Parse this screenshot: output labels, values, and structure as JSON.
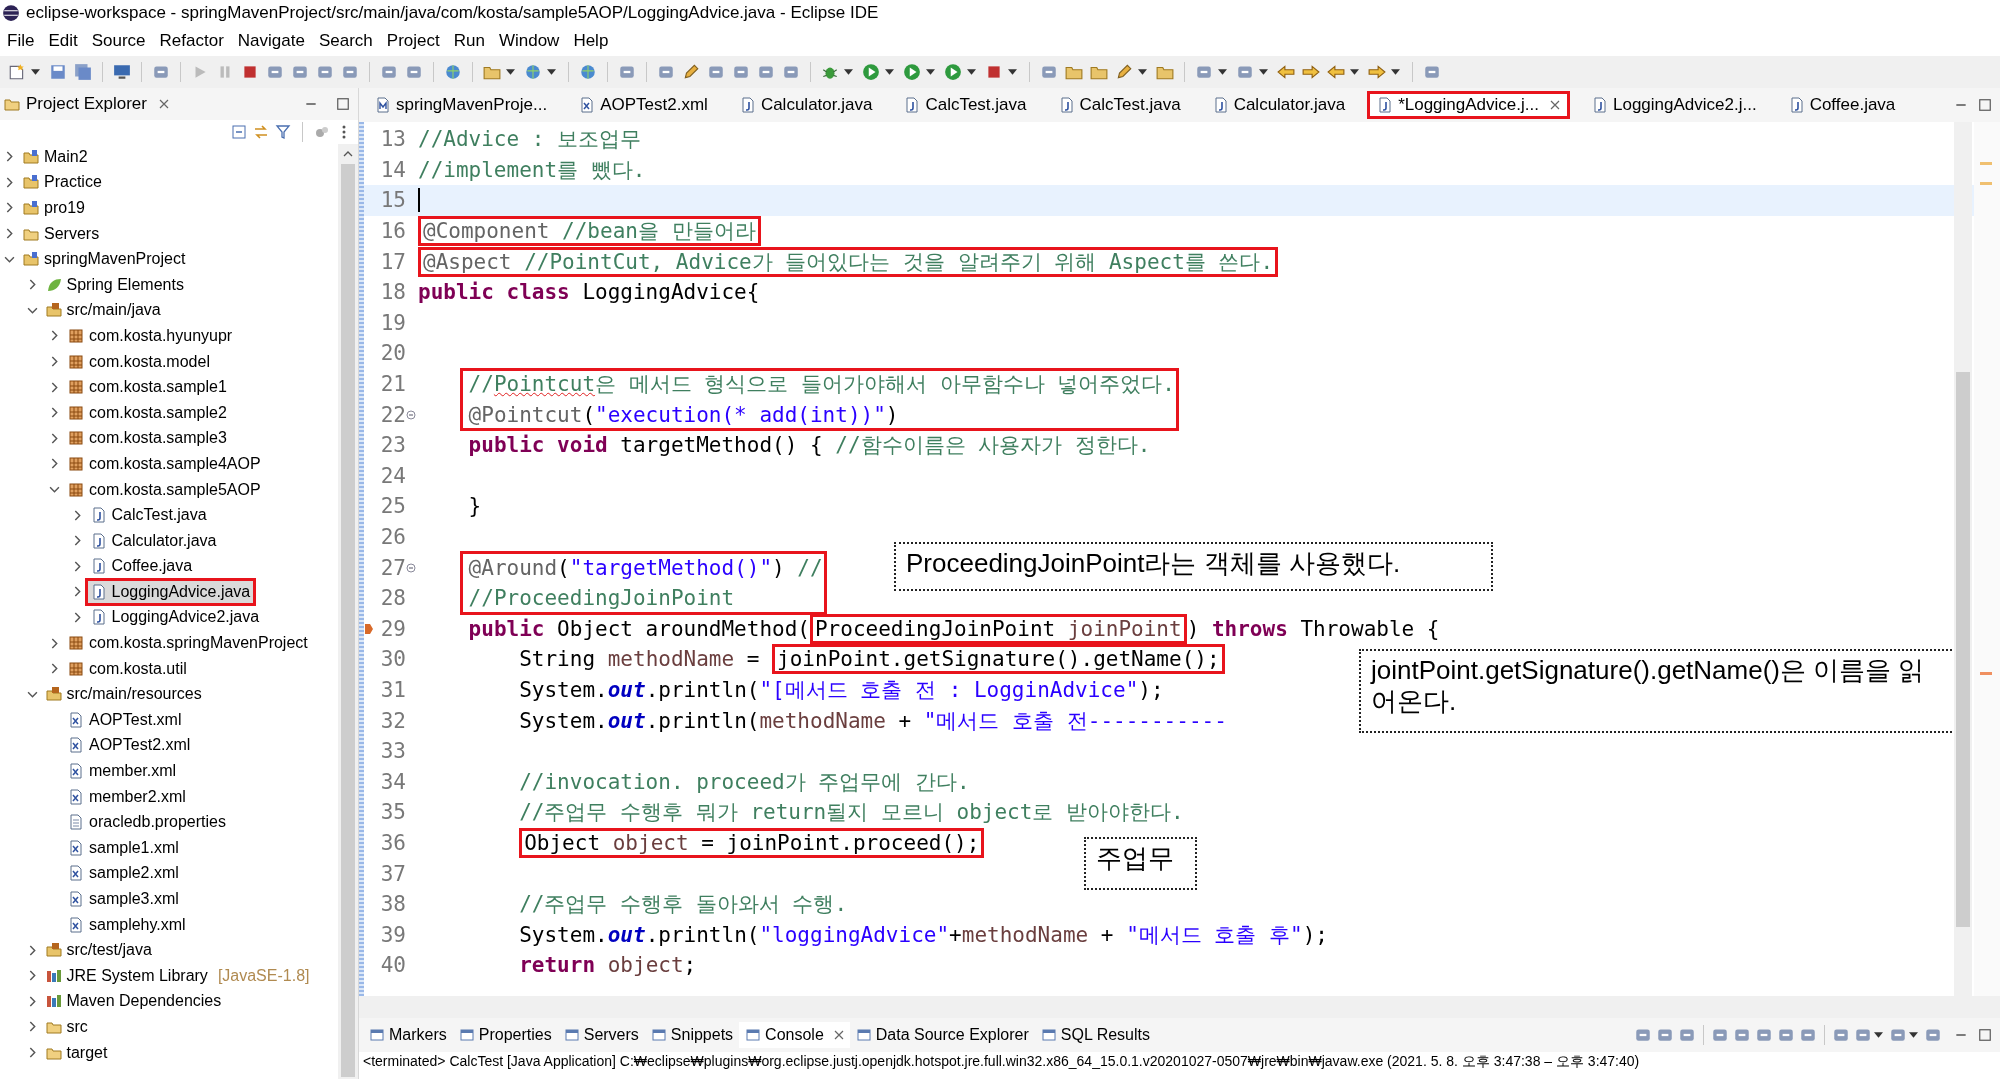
{
  "window": {
    "title": "eclipse-workspace - springMavenProject/src/main/java/com/kosta/sample5AOP/LoggingAdvice.java - Eclipse IDE"
  },
  "menu": [
    "File",
    "Edit",
    "Source",
    "Refactor",
    "Navigate",
    "Search",
    "Project",
    "Run",
    "Window",
    "Help"
  ],
  "project_explorer": {
    "title": "Project Explorer",
    "tree": [
      {
        "label": "Main2",
        "kind": "project",
        "expanded": false,
        "selected": false
      },
      {
        "label": "Practice",
        "kind": "project",
        "expanded": false,
        "selected": false
      },
      {
        "label": "pro19",
        "kind": "project",
        "expanded": false,
        "selected": false
      },
      {
        "label": "Servers",
        "kind": "folder",
        "expanded": false,
        "selected": false
      },
      {
        "label": "springMavenProject",
        "kind": "project",
        "expanded": true,
        "selected": false,
        "children": [
          {
            "label": "Spring Elements",
            "kind": "spring",
            "expanded": false,
            "selected": false
          },
          {
            "label": "src/main/java",
            "kind": "source",
            "expanded": true,
            "selected": false,
            "children": [
              {
                "label": "com.kosta.hyunyupr",
                "kind": "package",
                "expanded": false,
                "selected": false
              },
              {
                "label": "com.kosta.model",
                "kind": "package",
                "expanded": false,
                "selected": false
              },
              {
                "label": "com.kosta.sample1",
                "kind": "package",
                "expanded": false,
                "selected": false
              },
              {
                "label": "com.kosta.sample2",
                "kind": "package",
                "expanded": false,
                "selected": false
              },
              {
                "label": "com.kosta.sample3",
                "kind": "package",
                "expanded": false,
                "selected": false
              },
              {
                "label": "com.kosta.sample4AOP",
                "kind": "package",
                "expanded": false,
                "selected": false
              },
              {
                "label": "com.kosta.sample5AOP",
                "kind": "package",
                "expanded": true,
                "selected": false,
                "children": [
                  {
                    "label": "CalcTest.java",
                    "kind": "java",
                    "expanded": false,
                    "selected": false
                  },
                  {
                    "label": "Calculator.java",
                    "kind": "java",
                    "expanded": false,
                    "selected": false
                  },
                  {
                    "label": "Coffee.java",
                    "kind": "java",
                    "expanded": false,
                    "selected": false
                  },
                  {
                    "label": "LoggingAdvice.java",
                    "kind": "java",
                    "expanded": false,
                    "selected": true
                  },
                  {
                    "label": "LoggingAdvice2.java",
                    "kind": "java",
                    "expanded": false,
                    "selected": false
                  }
                ]
              },
              {
                "label": "com.kosta.springMavenProject",
                "kind": "package",
                "expanded": false,
                "selected": false
              },
              {
                "label": "com.kosta.util",
                "kind": "package",
                "expanded": false,
                "selected": false
              }
            ]
          },
          {
            "label": "src/main/resources",
            "kind": "source",
            "expanded": true,
            "selected": false,
            "children": [
              {
                "label": "AOPTest.xml",
                "kind": "xml",
                "selected": false
              },
              {
                "label": "AOPTest2.xml",
                "kind": "xml",
                "selected": false
              },
              {
                "label": "member.xml",
                "kind": "xml",
                "selected": false
              },
              {
                "label": "member2.xml",
                "kind": "xml",
                "selected": false
              },
              {
                "label": "oracledb.properties",
                "kind": "properties",
                "selected": false
              },
              {
                "label": "sample1.xml",
                "kind": "xml",
                "selected": false
              },
              {
                "label": "sample2.xml",
                "kind": "xml",
                "selected": false
              },
              {
                "label": "sample3.xml",
                "kind": "xml",
                "selected": false
              },
              {
                "label": "samplehy.xml",
                "kind": "xml",
                "selected": false
              }
            ]
          },
          {
            "label": "src/test/java",
            "kind": "source",
            "expanded": false,
            "selected": false
          },
          {
            "label": "JRE System Library",
            "decoration": "[JavaSE-1.8]",
            "kind": "library",
            "expanded": false,
            "selected": false
          },
          {
            "label": "Maven Dependencies",
            "kind": "library",
            "expanded": false,
            "selected": false
          },
          {
            "label": "src",
            "kind": "folder",
            "expanded": false,
            "selected": false
          },
          {
            "label": "target",
            "kind": "folder",
            "expanded": false,
            "selected": false
          }
        ]
      }
    ]
  },
  "editor": {
    "tabs": [
      {
        "label": "springMavenProje...",
        "kind": "maven",
        "selected": false
      },
      {
        "label": "AOPTest2.xml",
        "kind": "xml",
        "selected": false
      },
      {
        "label": "Calculator.java",
        "kind": "java",
        "selected": false
      },
      {
        "label": "CalcTest.java",
        "kind": "java",
        "selected": false
      },
      {
        "label": "CalcTest.java",
        "kind": "java",
        "selected": false
      },
      {
        "label": "Calculator.java",
        "kind": "java",
        "selected": false
      },
      {
        "label": "*LoggingAdvice.j...",
        "kind": "java",
        "selected": true
      },
      {
        "label": "LoggingAdvice2.j...",
        "kind": "java",
        "selected": false
      },
      {
        "label": "Coffee.java",
        "kind": "java",
        "selected": false
      }
    ],
    "lines": [
      {
        "number": "13",
        "foldable": false,
        "marker": false,
        "current": false,
        "tokens": [
          {
            "kind": "comment",
            "text": "//Advice : 보조업무"
          }
        ]
      },
      {
        "number": "14",
        "foldable": false,
        "marker": false,
        "current": false,
        "tokens": [
          {
            "kind": "comment",
            "text": "//implement를 뺐다."
          }
        ]
      },
      {
        "number": "15",
        "foldable": false,
        "marker": false,
        "current": true
      },
      {
        "number": "16",
        "foldable": false,
        "marker": false,
        "current": false,
        "tokens": [
          {
            "kind": "annotation",
            "text": "@Component "
          },
          {
            "kind": "comment",
            "text": "//bean을 만들어라"
          }
        ]
      },
      {
        "number": "17",
        "foldable": false,
        "marker": false,
        "current": false,
        "tokens": [
          {
            "kind": "annotation",
            "text": "@Aspect "
          },
          {
            "kind": "comment",
            "text": "//PointCut, Advice가 들어있다는 것을 알려주기 위해 Aspect를 쓴다."
          }
        ]
      },
      {
        "number": "18",
        "foldable": false,
        "marker": false,
        "current": false,
        "tokens": [
          {
            "kind": "keyword",
            "text": "public "
          },
          {
            "kind": "keyword",
            "text": "class"
          },
          {
            "kind": "plain",
            "text": " LoggingAdvice{"
          }
        ],
        "children": [
          {
            "number": "19",
            "foldable": false,
            "marker": false,
            "current": false
          },
          {
            "number": "20",
            "foldable": false,
            "marker": false,
            "current": false
          },
          {
            "number": "21",
            "foldable": false,
            "marker": false,
            "current": false,
            "tokens": [
              {
                "kind": "comment",
                "text": "//"
              },
              {
                "kind": "comment-typo",
                "text": "Pointcut"
              },
              {
                "kind": "comment",
                "text": "은 메서드 형식으로 들어가야해서 아무함수나 넣어주었다."
              }
            ]
          },
          {
            "number": "22",
            "foldable": true,
            "marker": false,
            "current": false,
            "tokens": [
              {
                "kind": "annotation",
                "text": "@Pointcut"
              },
              {
                "kind": "plain",
                "text": "("
              },
              {
                "kind": "string",
                "text": "\"execution(* add(int))\""
              },
              {
                "kind": "plain",
                "text": ")"
              }
            ]
          },
          {
            "number": "23",
            "foldable": false,
            "marker": false,
            "current": false,
            "tokens": [
              {
                "kind": "keyword",
                "text": "public "
              },
              {
                "kind": "keyword",
                "text": "void"
              },
              {
                "kind": "plain",
                "text": " targetMethod() { "
              },
              {
                "kind": "comment",
                "text": "//함수이름은 사용자가 정한다."
              }
            ]
          },
          {
            "number": "24",
            "foldable": false,
            "marker": false,
            "current": false
          },
          {
            "number": "25",
            "foldable": false,
            "marker": false,
            "current": false,
            "tokens": [
              {
                "kind": "plain",
                "text": "}"
              }
            ]
          },
          {
            "number": "26",
            "foldable": false,
            "marker": false,
            "current": false
          },
          {
            "number": "27",
            "foldable": true,
            "marker": false,
            "current": false,
            "tokens": [
              {
                "kind": "annotation",
                "text": "@Around"
              },
              {
                "kind": "plain",
                "text": "("
              },
              {
                "kind": "string",
                "text": "\"targetMethod()\""
              },
              {
                "kind": "plain",
                "text": ") "
              },
              {
                "kind": "comment",
                "text": "//"
              }
            ]
          },
          {
            "number": "28",
            "foldable": false,
            "marker": false,
            "current": false,
            "tokens": [
              {
                "kind": "comment",
                "text": "//ProceedingJoinPoint"
              }
            ]
          },
          {
            "number": "29",
            "foldable": false,
            "marker": true,
            "current": false,
            "tokens": [
              {
                "kind": "keyword",
                "text": "public"
              },
              {
                "kind": "plain",
                "text": " Object aroundMethod("
              },
              {
                "kind": "plain",
                "text": "ProceedingJoinPoint "
              },
              {
                "kind": "local",
                "text": "joinPoint"
              },
              {
                "kind": "plain",
                "text": ") "
              },
              {
                "kind": "keyword",
                "text": "throws"
              },
              {
                "kind": "plain",
                "text": " Throwable {"
              }
            ],
            "children": [
              {
                "number": "30",
                "foldable": false,
                "marker": false,
                "current": false,
                "tokens": [
                  {
                    "kind": "plain",
                    "text": "String "
                  },
                  {
                    "kind": "local",
                    "text": "methodName"
                  },
                  {
                    "kind": "plain",
                    "text": " = "
                  },
                  {
                    "kind": "plain",
                    "text": "joinPoint.getSignature().getName();"
                  }
                ]
              },
              {
                "number": "31",
                "foldable": false,
                "marker": false,
                "current": false,
                "tokens": [
                  {
                    "kind": "plain",
                    "text": "System."
                  },
                  {
                    "kind": "field",
                    "text": "out"
                  },
                  {
                    "kind": "plain",
                    "text": ".println("
                  },
                  {
                    "kind": "string",
                    "text": "\"[메서드 호출 전 : LogginAdvice\""
                  },
                  {
                    "kind": "plain",
                    "text": ");"
                  }
                ]
              },
              {
                "number": "32",
                "foldable": false,
                "marker": false,
                "current": false,
                "tokens": [
                  {
                    "kind": "plain",
                    "text": "System."
                  },
                  {
                    "kind": "field",
                    "text": "out"
                  },
                  {
                    "kind": "plain",
                    "text": ".println("
                  },
                  {
                    "kind": "local",
                    "text": "methodName"
                  },
                  {
                    "kind": "plain",
                    "text": " + "
                  },
                  {
                    "kind": "string",
                    "text": "\"메서드 호출 전-----------"
                  }
                ]
              },
              {
                "number": "33",
                "foldable": false,
                "marker": false,
                "current": false
              },
              {
                "number": "34",
                "foldable": false,
                "marker": false,
                "current": false,
                "tokens": [
                  {
                    "kind": "comment",
                    "text": "//invocation. proceed가 주업무에 간다."
                  }
                ]
              },
              {
                "number": "35",
                "foldable": false,
                "marker": false,
                "current": false,
                "tokens": [
                  {
                    "kind": "comment",
                    "text": "//주업무 수행후 뭐가 return될지 모르니 object로 받아야한다."
                  }
                ]
              },
              {
                "number": "36",
                "foldable": false,
                "marker": false,
                "current": false,
                "tokens": [
                  {
                    "kind": "plain",
                    "text": "Object "
                  },
                  {
                    "kind": "local",
                    "text": "object"
                  },
                  {
                    "kind": "plain",
                    "text": " = joinPoint.proceed();"
                  }
                ]
              },
              {
                "number": "37",
                "foldable": false,
                "marker": false,
                "current": false
              },
              {
                "number": "38",
                "foldable": false,
                "marker": false,
                "current": false,
                "tokens": [
                  {
                    "kind": "comment",
                    "text": "//주업무 수행후 돌아와서 수행."
                  }
                ]
              },
              {
                "number": "39",
                "foldable": false,
                "marker": false,
                "current": false,
                "tokens": [
                  {
                    "kind": "plain",
                    "text": "System."
                  },
                  {
                    "kind": "field",
                    "text": "out"
                  },
                  {
                    "kind": "plain",
                    "text": ".println("
                  },
                  {
                    "kind": "string",
                    "text": "\"loggingAdvice\""
                  },
                  {
                    "kind": "plain",
                    "text": "+"
                  },
                  {
                    "kind": "local",
                    "text": "methodName"
                  },
                  {
                    "kind": "plain",
                    "text": " + "
                  },
                  {
                    "kind": "string",
                    "text": "\"메서드 호출 후\""
                  },
                  {
                    "kind": "plain",
                    "text": ");"
                  }
                ]
              },
              {
                "number": "40",
                "foldable": false,
                "marker": false,
                "current": false,
                "tokens": [
                  {
                    "kind": "keyword",
                    "text": "return "
                  },
                  {
                    "kind": "local",
                    "text": "object"
                  },
                  {
                    "kind": "plain",
                    "text": ";"
                  }
                ]
              }
            ]
          }
        ]
      }
    ]
  },
  "callouts": [
    {
      "text": "ProceedingJoinPoint라는 객체를 사용했다."
    },
    {
      "text": "jointPoint.getSignature().getName()은 이름을 읽어온다."
    },
    {
      "text": "주업무"
    }
  ],
  "bottom_panel": {
    "tabs": [
      {
        "label": "Markers",
        "selected": false
      },
      {
        "label": "Properties",
        "selected": false
      },
      {
        "label": "Servers",
        "selected": false
      },
      {
        "label": "Snippets",
        "selected": false
      },
      {
        "label": "Console",
        "selected": true
      },
      {
        "label": "Data Source Explorer",
        "selected": false
      },
      {
        "label": "SQL Results",
        "selected": false
      }
    ],
    "console_line": "<terminated> CalcTest [Java Application] C:₩eclipse₩plugins₩org.eclipse.justj.openjdk.hotspot.jre.full.win32.x86_64_15.0.1.v20201027-0507₩jre₩bin₩javaw.exe  (2021. 5. 8. 오후 3:47:38 – 오후 3:47:40)"
  }
}
